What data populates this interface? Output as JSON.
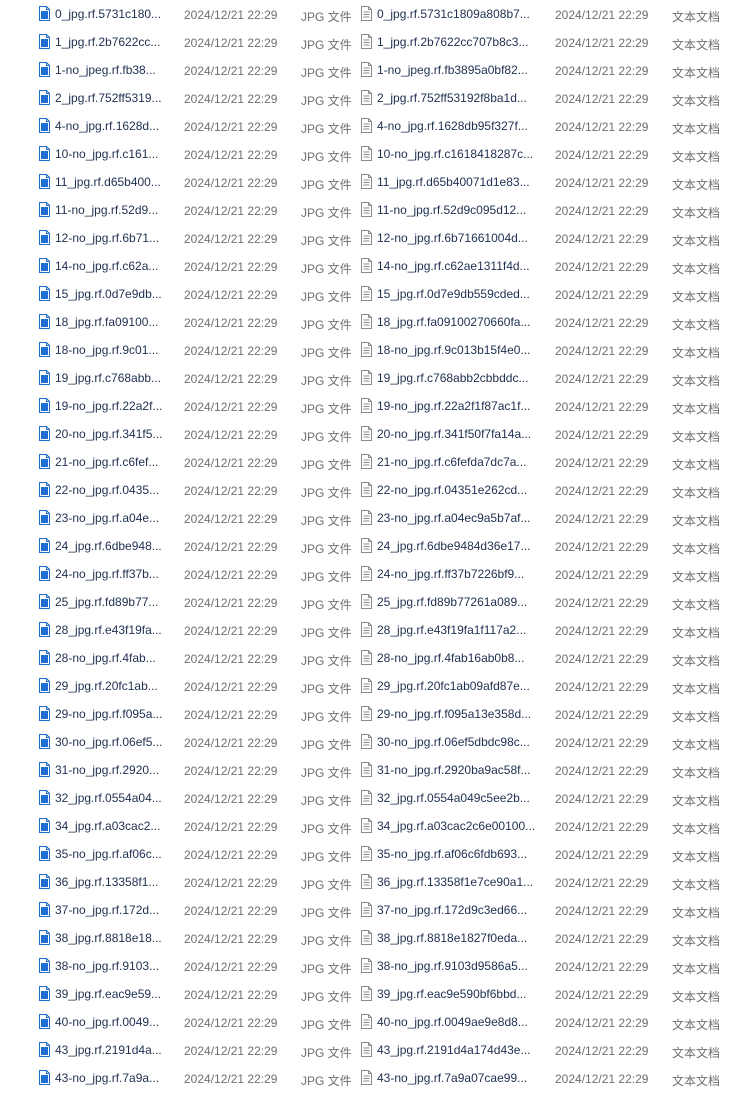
{
  "left_files": [
    {
      "name": "0_jpg.rf.5731c180...",
      "date": "2024/12/21 22:29",
      "type": "JPG 文件"
    },
    {
      "name": "1_jpg.rf.2b7622cc...",
      "date": "2024/12/21 22:29",
      "type": "JPG 文件"
    },
    {
      "name": "1-no_jpeg.rf.fb38...",
      "date": "2024/12/21 22:29",
      "type": "JPG 文件"
    },
    {
      "name": "2_jpg.rf.752ff5319...",
      "date": "2024/12/21 22:29",
      "type": "JPG 文件"
    },
    {
      "name": "4-no_jpg.rf.1628d...",
      "date": "2024/12/21 22:29",
      "type": "JPG 文件"
    },
    {
      "name": "10-no_jpg.rf.c161...",
      "date": "2024/12/21 22:29",
      "type": "JPG 文件"
    },
    {
      "name": "11_jpg.rf.d65b400...",
      "date": "2024/12/21 22:29",
      "type": "JPG 文件"
    },
    {
      "name": "11-no_jpg.rf.52d9...",
      "date": "2024/12/21 22:29",
      "type": "JPG 文件"
    },
    {
      "name": "12-no_jpg.rf.6b71...",
      "date": "2024/12/21 22:29",
      "type": "JPG 文件"
    },
    {
      "name": "14-no_jpg.rf.c62a...",
      "date": "2024/12/21 22:29",
      "type": "JPG 文件"
    },
    {
      "name": "15_jpg.rf.0d7e9db...",
      "date": "2024/12/21 22:29",
      "type": "JPG 文件"
    },
    {
      "name": "18_jpg.rf.fa09100...",
      "date": "2024/12/21 22:29",
      "type": "JPG 文件"
    },
    {
      "name": "18-no_jpg.rf.9c01...",
      "date": "2024/12/21 22:29",
      "type": "JPG 文件"
    },
    {
      "name": "19_jpg.rf.c768abb...",
      "date": "2024/12/21 22:29",
      "type": "JPG 文件"
    },
    {
      "name": "19-no_jpg.rf.22a2f...",
      "date": "2024/12/21 22:29",
      "type": "JPG 文件"
    },
    {
      "name": "20-no_jpg.rf.341f5...",
      "date": "2024/12/21 22:29",
      "type": "JPG 文件"
    },
    {
      "name": "21-no_jpg.rf.c6fef...",
      "date": "2024/12/21 22:29",
      "type": "JPG 文件"
    },
    {
      "name": "22-no_jpg.rf.0435...",
      "date": "2024/12/21 22:29",
      "type": "JPG 文件"
    },
    {
      "name": "23-no_jpg.rf.a04e...",
      "date": "2024/12/21 22:29",
      "type": "JPG 文件"
    },
    {
      "name": "24_jpg.rf.6dbe948...",
      "date": "2024/12/21 22:29",
      "type": "JPG 文件"
    },
    {
      "name": "24-no_jpg.rf.ff37b...",
      "date": "2024/12/21 22:29",
      "type": "JPG 文件"
    },
    {
      "name": "25_jpg.rf.fd89b77...",
      "date": "2024/12/21 22:29",
      "type": "JPG 文件"
    },
    {
      "name": "28_jpg.rf.e43f19fa...",
      "date": "2024/12/21 22:29",
      "type": "JPG 文件"
    },
    {
      "name": "28-no_jpg.rf.4fab...",
      "date": "2024/12/21 22:29",
      "type": "JPG 文件"
    },
    {
      "name": "29_jpg.rf.20fc1ab...",
      "date": "2024/12/21 22:29",
      "type": "JPG 文件"
    },
    {
      "name": "29-no_jpg.rf.f095a...",
      "date": "2024/12/21 22:29",
      "type": "JPG 文件"
    },
    {
      "name": "30-no_jpg.rf.06ef5...",
      "date": "2024/12/21 22:29",
      "type": "JPG 文件"
    },
    {
      "name": "31-no_jpg.rf.2920...",
      "date": "2024/12/21 22:29",
      "type": "JPG 文件"
    },
    {
      "name": "32_jpg.rf.0554a04...",
      "date": "2024/12/21 22:29",
      "type": "JPG 文件"
    },
    {
      "name": "34_jpg.rf.a03cac2...",
      "date": "2024/12/21 22:29",
      "type": "JPG 文件"
    },
    {
      "name": "35-no_jpg.rf.af06c...",
      "date": "2024/12/21 22:29",
      "type": "JPG 文件"
    },
    {
      "name": "36_jpg.rf.13358f1...",
      "date": "2024/12/21 22:29",
      "type": "JPG 文件"
    },
    {
      "name": "37-no_jpg.rf.172d...",
      "date": "2024/12/21 22:29",
      "type": "JPG 文件"
    },
    {
      "name": "38_jpg.rf.8818e18...",
      "date": "2024/12/21 22:29",
      "type": "JPG 文件"
    },
    {
      "name": "38-no_jpg.rf.9103...",
      "date": "2024/12/21 22:29",
      "type": "JPG 文件"
    },
    {
      "name": "39_jpg.rf.eac9e59...",
      "date": "2024/12/21 22:29",
      "type": "JPG 文件"
    },
    {
      "name": "40-no_jpg.rf.0049...",
      "date": "2024/12/21 22:29",
      "type": "JPG 文件"
    },
    {
      "name": "43_jpg.rf.2191d4a...",
      "date": "2024/12/21 22:29",
      "type": "JPG 文件"
    },
    {
      "name": "43-no_jpg.rf.7a9a...",
      "date": "2024/12/21 22:29",
      "type": "JPG 文件"
    }
  ],
  "right_files": [
    {
      "name": "0_jpg.rf.5731c1809a808b7...",
      "date": "2024/12/21 22:29",
      "type": "文本文档"
    },
    {
      "name": "1_jpg.rf.2b7622cc707b8c3...",
      "date": "2024/12/21 22:29",
      "type": "文本文档"
    },
    {
      "name": "1-no_jpeg.rf.fb3895a0bf82...",
      "date": "2024/12/21 22:29",
      "type": "文本文档"
    },
    {
      "name": "2_jpg.rf.752ff53192f8ba1d...",
      "date": "2024/12/21 22:29",
      "type": "文本文档"
    },
    {
      "name": "4-no_jpg.rf.1628db95f327f...",
      "date": "2024/12/21 22:29",
      "type": "文本文档"
    },
    {
      "name": "10-no_jpg.rf.c1618418287c...",
      "date": "2024/12/21 22:29",
      "type": "文本文档"
    },
    {
      "name": "11_jpg.rf.d65b40071d1e83...",
      "date": "2024/12/21 22:29",
      "type": "文本文档"
    },
    {
      "name": "11-no_jpg.rf.52d9c095d12...",
      "date": "2024/12/21 22:29",
      "type": "文本文档"
    },
    {
      "name": "12-no_jpg.rf.6b71661004d...",
      "date": "2024/12/21 22:29",
      "type": "文本文档"
    },
    {
      "name": "14-no_jpg.rf.c62ae1311f4d...",
      "date": "2024/12/21 22:29",
      "type": "文本文档"
    },
    {
      "name": "15_jpg.rf.0d7e9db559cded...",
      "date": "2024/12/21 22:29",
      "type": "文本文档"
    },
    {
      "name": "18_jpg.rf.fa09100270660fa...",
      "date": "2024/12/21 22:29",
      "type": "文本文档"
    },
    {
      "name": "18-no_jpg.rf.9c013b15f4e0...",
      "date": "2024/12/21 22:29",
      "type": "文本文档"
    },
    {
      "name": "19_jpg.rf.c768abb2cbbddc...",
      "date": "2024/12/21 22:29",
      "type": "文本文档"
    },
    {
      "name": "19-no_jpg.rf.22a2f1f87ac1f...",
      "date": "2024/12/21 22:29",
      "type": "文本文档"
    },
    {
      "name": "20-no_jpg.rf.341f50f7fa14a...",
      "date": "2024/12/21 22:29",
      "type": "文本文档"
    },
    {
      "name": "21-no_jpg.rf.c6fefda7dc7a...",
      "date": "2024/12/21 22:29",
      "type": "文本文档"
    },
    {
      "name": "22-no_jpg.rf.04351e262cd...",
      "date": "2024/12/21 22:29",
      "type": "文本文档"
    },
    {
      "name": "23-no_jpg.rf.a04ec9a5b7af...",
      "date": "2024/12/21 22:29",
      "type": "文本文档"
    },
    {
      "name": "24_jpg.rf.6dbe9484d36e17...",
      "date": "2024/12/21 22:29",
      "type": "文本文档"
    },
    {
      "name": "24-no_jpg.rf.ff37b7226bf9...",
      "date": "2024/12/21 22:29",
      "type": "文本文档"
    },
    {
      "name": "25_jpg.rf.fd89b77261a089...",
      "date": "2024/12/21 22:29",
      "type": "文本文档"
    },
    {
      "name": "28_jpg.rf.e43f19fa1f117a2...",
      "date": "2024/12/21 22:29",
      "type": "文本文档"
    },
    {
      "name": "28-no_jpg.rf.4fab16ab0b8...",
      "date": "2024/12/21 22:29",
      "type": "文本文档"
    },
    {
      "name": "29_jpg.rf.20fc1ab09afd87e...",
      "date": "2024/12/21 22:29",
      "type": "文本文档"
    },
    {
      "name": "29-no_jpg.rf.f095a13e358d...",
      "date": "2024/12/21 22:29",
      "type": "文本文档"
    },
    {
      "name": "30-no_jpg.rf.06ef5dbdc98c...",
      "date": "2024/12/21 22:29",
      "type": "文本文档"
    },
    {
      "name": "31-no_jpg.rf.2920ba9ac58f...",
      "date": "2024/12/21 22:29",
      "type": "文本文档"
    },
    {
      "name": "32_jpg.rf.0554a049c5ee2b...",
      "date": "2024/12/21 22:29",
      "type": "文本文档"
    },
    {
      "name": "34_jpg.rf.a03cac2c6e00100...",
      "date": "2024/12/21 22:29",
      "type": "文本文档"
    },
    {
      "name": "35-no_jpg.rf.af06c6fdb693...",
      "date": "2024/12/21 22:29",
      "type": "文本文档"
    },
    {
      "name": "36_jpg.rf.13358f1e7ce90a1...",
      "date": "2024/12/21 22:29",
      "type": "文本文档"
    },
    {
      "name": "37-no_jpg.rf.172d9c3ed66...",
      "date": "2024/12/21 22:29",
      "type": "文本文档"
    },
    {
      "name": "38_jpg.rf.8818e1827f0eda...",
      "date": "2024/12/21 22:29",
      "type": "文本文档"
    },
    {
      "name": "38-no_jpg.rf.9103d9586a5...",
      "date": "2024/12/21 22:29",
      "type": "文本文档"
    },
    {
      "name": "39_jpg.rf.eac9e590bf6bbd...",
      "date": "2024/12/21 22:29",
      "type": "文本文档"
    },
    {
      "name": "40-no_jpg.rf.0049ae9e8d8...",
      "date": "2024/12/21 22:29",
      "type": "文本文档"
    },
    {
      "name": "43_jpg.rf.2191d4a174d43e...",
      "date": "2024/12/21 22:29",
      "type": "文本文档"
    },
    {
      "name": "43-no_jpg.rf.7a9a07cae99...",
      "date": "2024/12/21 22:29",
      "type": "文本文档"
    }
  ],
  "icons": {
    "left": "jpg-file-icon",
    "right": "text-file-icon"
  },
  "colors": {
    "name_text": "#1e2f4f",
    "meta_text": "#6f6f6f",
    "jpg_icon_fill": "#1f6fd1",
    "txt_icon_fill": "#ffffff",
    "txt_icon_stroke": "#8a8a8a"
  }
}
